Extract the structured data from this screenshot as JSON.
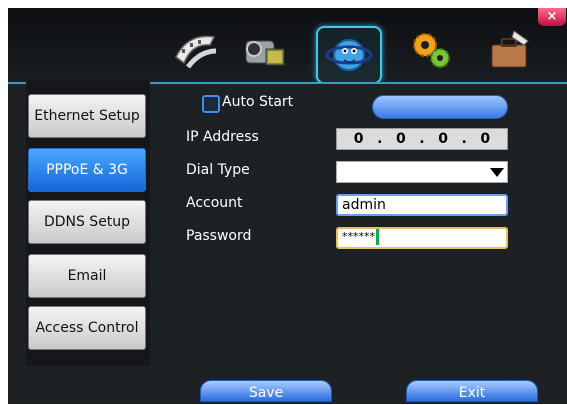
{
  "window": {
    "close_label": "×"
  },
  "top_icons": [
    {
      "name": "record-icon",
      "active": false
    },
    {
      "name": "camera-icon",
      "active": false
    },
    {
      "name": "network-icon",
      "active": true
    },
    {
      "name": "settings-gears-icon",
      "active": false
    },
    {
      "name": "tools-case-icon",
      "active": false
    }
  ],
  "sidebar": {
    "items": [
      {
        "label": "Ethernet Setup",
        "active": false
      },
      {
        "label": "PPPoE & 3G",
        "active": true
      },
      {
        "label": "DDNS Setup",
        "active": false
      },
      {
        "label": "Email",
        "active": false
      },
      {
        "label": "Access Control",
        "active": false
      }
    ]
  },
  "form": {
    "auto_start_label": "Auto Start",
    "auto_start_checked": false,
    "ip_address_label": "IP Address",
    "ip_octets": [
      "0",
      "0",
      "0",
      "0"
    ],
    "ip_sep": ".",
    "dial_type_label": "Dial Type",
    "dial_type_value": "",
    "account_label": "Account",
    "account_value": "admin",
    "password_label": "Password",
    "password_value": "******"
  },
  "footer": {
    "save_label": "Save",
    "exit_label": "Exit"
  },
  "colors": {
    "accent_blue": "#1466d9",
    "active_border": "#44c8e8",
    "focus_border": "#e8c060"
  }
}
